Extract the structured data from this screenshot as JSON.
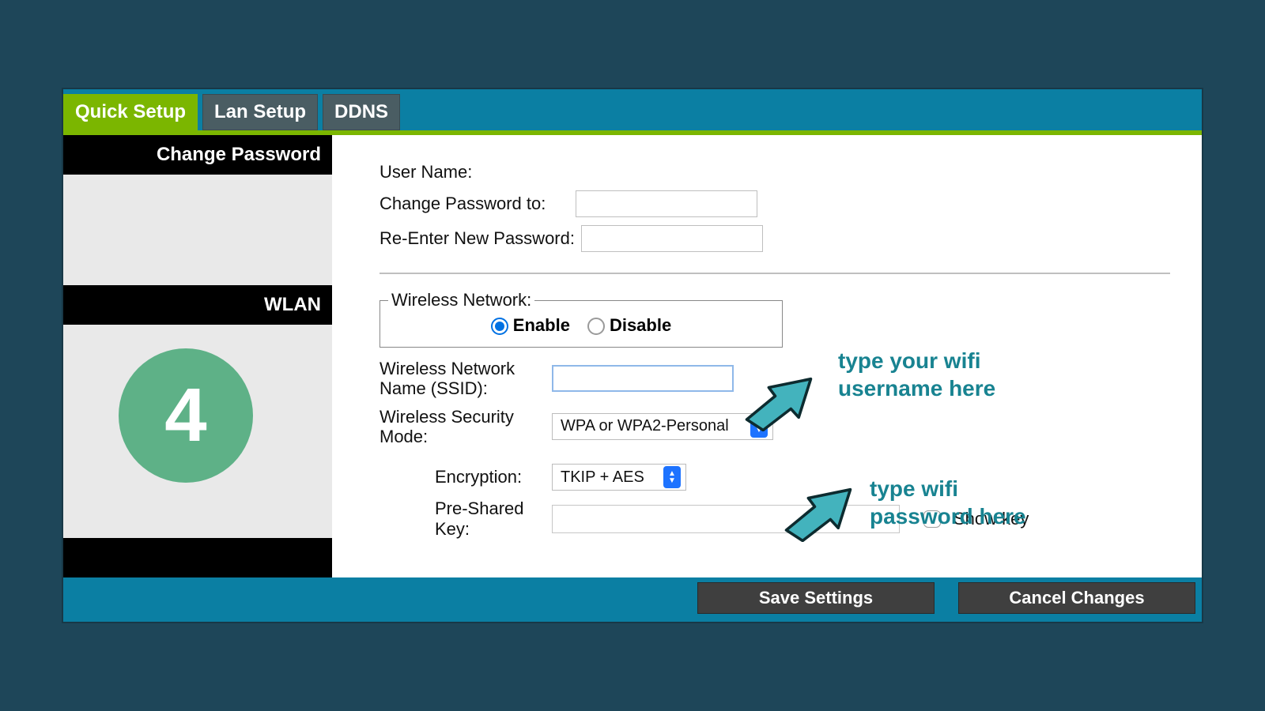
{
  "tabs": [
    {
      "label": "Quick Setup",
      "active": true
    },
    {
      "label": "Lan Setup",
      "active": false
    },
    {
      "label": "DDNS",
      "active": false
    }
  ],
  "sidebar": {
    "change_password": "Change Password",
    "wlan": "WLAN"
  },
  "step_number": "4",
  "form": {
    "user_name_label": "User Name:",
    "change_pw_label": "Change Password to:",
    "reenter_pw_label": "Re-Enter New Password:",
    "wireless_legend": "Wireless Network:",
    "enable": "Enable",
    "disable": "Disable",
    "ssid_label": "Wireless Network Name (SSID):",
    "secmode_label": "Wireless Security Mode:",
    "secmode_value": "WPA or WPA2-Personal",
    "encryption_label": "Encryption:",
    "encryption_value": "TKIP + AES",
    "psk_label": "Pre-Shared Key:",
    "showkey_label": "Show key"
  },
  "annotations": {
    "ssid": "type your wifi username here",
    "psk": "type wifi password here"
  },
  "buttons": {
    "save": "Save Settings",
    "cancel": "Cancel Changes"
  }
}
